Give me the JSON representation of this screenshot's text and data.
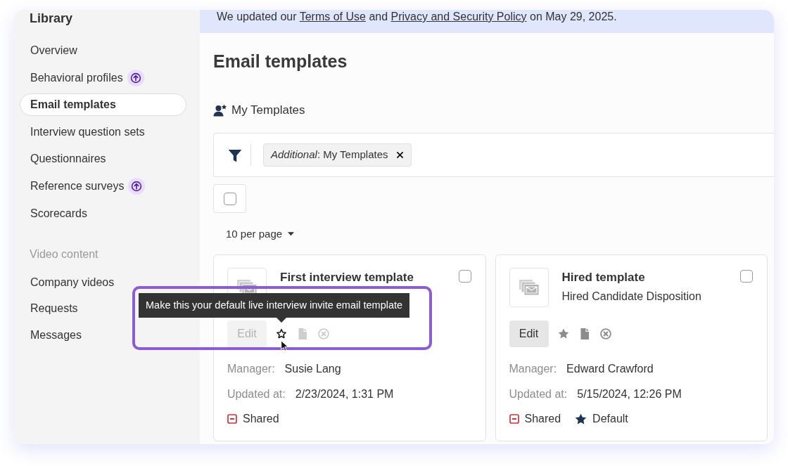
{
  "sidebar": {
    "title": "Library",
    "groups": [
      {
        "items": [
          {
            "label": "Overview",
            "selected": false,
            "upgrade": false
          },
          {
            "label": "Behavioral profiles",
            "selected": false,
            "upgrade": true
          },
          {
            "label": "Email templates",
            "selected": true,
            "upgrade": false
          },
          {
            "label": "Interview question sets",
            "selected": false,
            "upgrade": false
          },
          {
            "label": "Questionnaires",
            "selected": false,
            "upgrade": false
          },
          {
            "label": "Reference surveys",
            "selected": false,
            "upgrade": true
          },
          {
            "label": "Scorecards",
            "selected": false,
            "upgrade": false
          }
        ]
      },
      {
        "heading": "Video content",
        "items": [
          {
            "label": "Company videos",
            "selected": false,
            "upgrade": false
          },
          {
            "label": "Requests",
            "selected": false,
            "upgrade": false
          },
          {
            "label": "Messages",
            "selected": false,
            "upgrade": false
          }
        ]
      }
    ]
  },
  "banner": {
    "segments": [
      {
        "kind": "text",
        "text": "We updated our "
      },
      {
        "kind": "link",
        "text": "Terms of Use"
      },
      {
        "kind": "text",
        "text": " and "
      },
      {
        "kind": "link",
        "text": "Privacy and Security Policy"
      },
      {
        "kind": "text",
        "text": " on May 29, 2025."
      }
    ]
  },
  "page": {
    "title": "Email templates"
  },
  "view": {
    "label": "My Templates"
  },
  "filters": [
    {
      "label": "*Additional*: My Templates"
    }
  ],
  "select_all": {
    "checked": false
  },
  "page_size": {
    "label": "10 per page"
  },
  "cards": [
    {
      "title": "First interview template",
      "checked": false,
      "edit": {
        "label": "Edit",
        "disabled": true
      },
      "actions": [
        {
          "kind": "star",
          "disabled": false,
          "hovered": true,
          "tooltip": "Make this your default live interview invite email template"
        },
        {
          "kind": "file",
          "disabled": true,
          "hovered": false
        },
        {
          "kind": "remove",
          "disabled": true,
          "hovered": false
        }
      ],
      "fields": [
        {
          "label": "Manager:",
          "value": "Susie Lang"
        },
        {
          "label": "Updated at:",
          "value": "2/23/2024, 1:31 PM"
        }
      ],
      "tags": [
        {
          "kind": "shared",
          "label": "Shared"
        }
      ]
    },
    {
      "title": "Hired template",
      "subtitle": "Hired Candidate Disposition",
      "checked": false,
      "edit": {
        "label": "Edit",
        "disabled": false
      },
      "actions": [
        {
          "kind": "star",
          "disabled": false,
          "hovered": false
        },
        {
          "kind": "file",
          "disabled": false,
          "hovered": false
        },
        {
          "kind": "remove",
          "disabled": false,
          "hovered": false
        }
      ],
      "fields": [
        {
          "label": "Manager:",
          "value": "Edward Crawford"
        },
        {
          "label": "Updated at:",
          "value": "5/15/2024, 12:26 PM"
        }
      ],
      "tags": [
        {
          "kind": "shared",
          "label": "Shared"
        },
        {
          "kind": "default",
          "label": "Default"
        }
      ]
    }
  ]
}
